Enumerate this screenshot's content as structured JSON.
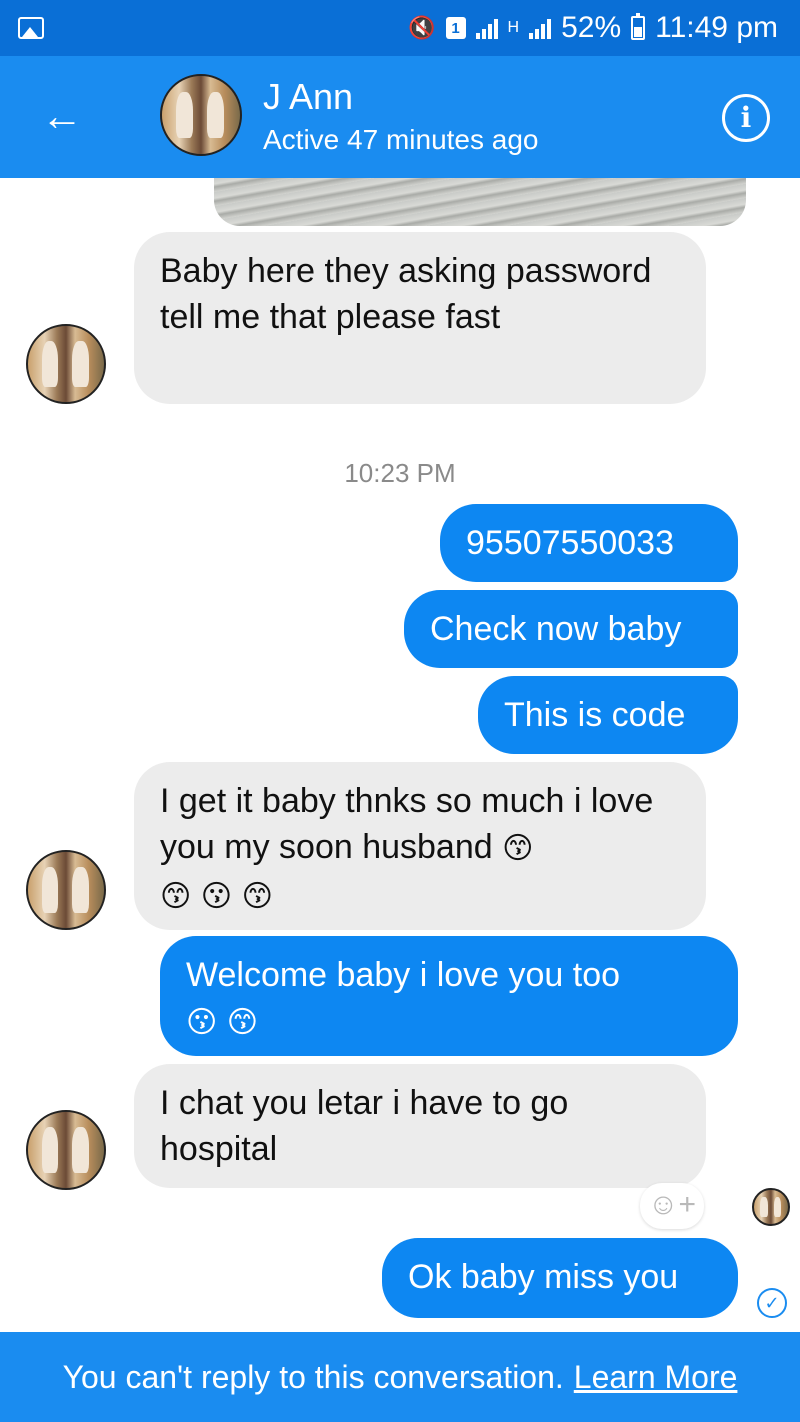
{
  "status_bar": {
    "battery_percent": "52%",
    "time": "11:49 pm",
    "sim_slot": "1",
    "network_type": "H",
    "icons": [
      "gallery-icon",
      "mute-icon",
      "sim-icon",
      "signal-icon",
      "battery-icon"
    ]
  },
  "header": {
    "contact_name": "J Ann",
    "active_status": "Active 47 minutes ago",
    "back_icon": "arrow-left",
    "info_icon": "info-circle"
  },
  "conversation": {
    "timestamp": "10:23 PM",
    "messages": [
      {
        "direction": "incoming",
        "text": "Baby here they asking password tell me that please fast"
      },
      {
        "direction": "outgoing",
        "text": "95507550033"
      },
      {
        "direction": "outgoing",
        "text": "Check now baby"
      },
      {
        "direction": "outgoing",
        "text": "This is code"
      },
      {
        "direction": "incoming",
        "text": "I get it baby thnks so much i love you my soon husband",
        "emojis": "😙\n😙 😗 😙"
      },
      {
        "direction": "outgoing",
        "text": "Welcome baby i love you too",
        "emojis": "😗 😙"
      },
      {
        "direction": "incoming",
        "text": "I chat you letar i have to go hospital"
      },
      {
        "direction": "outgoing",
        "text": "Ok baby miss you"
      }
    ],
    "reaction_label": "☺+",
    "delivered_mark": "✓"
  },
  "footer": {
    "notice": "You can't reply to this conversation.",
    "learn_more": "Learn More"
  },
  "colors": {
    "status_bar": "#0a6fd6",
    "header": "#1a8cf0",
    "outgoing_bubble": "#0d87f2",
    "incoming_bubble": "#ececec",
    "footer": "#1a8cf0"
  }
}
